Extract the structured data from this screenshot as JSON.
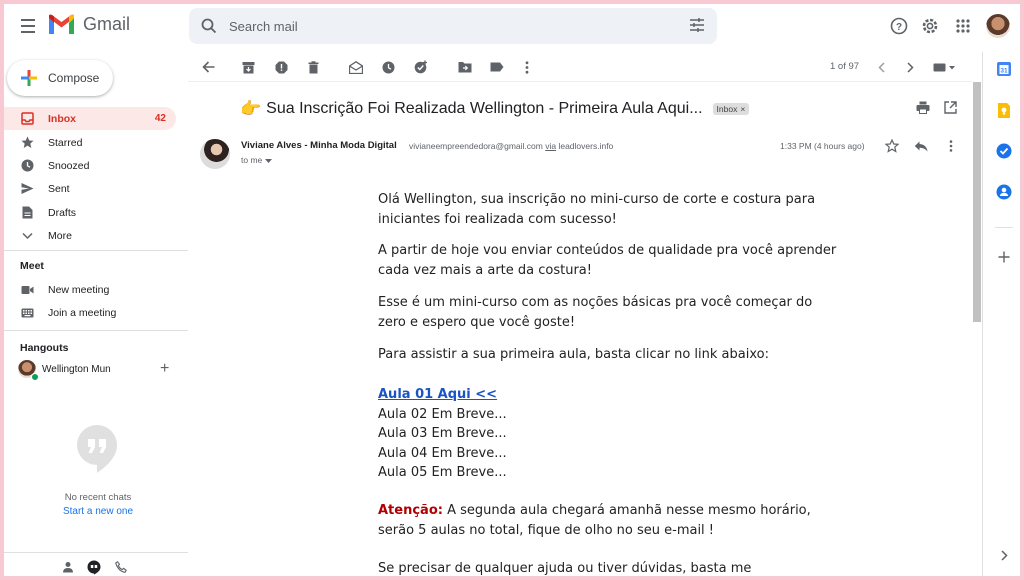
{
  "header": {
    "app_name": "Gmail",
    "search_placeholder": "Search mail"
  },
  "sidebar": {
    "compose_label": "Compose",
    "items": [
      {
        "label": "Inbox",
        "count": "42"
      },
      {
        "label": "Starred"
      },
      {
        "label": "Snoozed"
      },
      {
        "label": "Sent"
      },
      {
        "label": "Drafts"
      },
      {
        "label": "More"
      }
    ],
    "meet": {
      "title": "Meet",
      "new_meeting": "New meeting",
      "join_meeting": "Join a meeting"
    },
    "hangouts": {
      "title": "Hangouts",
      "user_name": "Wellington Mun",
      "no_recent": "No recent chats",
      "start_new": "Start a new one"
    }
  },
  "toolbar": {
    "pager": "1 of 97"
  },
  "email": {
    "subject": "Sua Inscrição Foi Realizada Wellington - Primeira Aula Aqui...",
    "label_chip": "Inbox",
    "sender_name": "Viviane Alves - Minha Moda Digital",
    "sender_email": "vivianeempreendedora@gmail.com",
    "via_text": "via",
    "via_domain": "leadlovers.info",
    "to": "to me",
    "time": "1:33 PM (4 hours ago)",
    "paragraphs": [
      "Olá Wellington, sua inscrição no mini-curso de corte e costura para iniciantes foi realizada com sucesso!",
      "A partir de hoje vou enviar conteúdos de qualidade pra você aprender cada vez mais a arte da costura!",
      "Esse é um mini-curso com as noções básicas pra você começar do zero e espero que você goste!",
      "Para assistir a sua primeira aula, basta clicar no link abaixo:"
    ],
    "aula_link": "Aula 01 Aqui <<",
    "aulas": [
      "Aula 02 Em Breve...",
      "Aula 03 Em Breve...",
      "Aula 04 Em Breve...",
      "Aula 05 Em Breve..."
    ],
    "atencao_label": "Atenção:",
    "atencao_text": "A segunda aula chegará amanhã nesse mesmo horário, serão 5 aulas no total, fique de olho no seu e-mail !",
    "last_line": "Se precisar de qualquer ajuda ou tiver dúvidas, basta me"
  },
  "colors": {
    "accent_red": "#d93025",
    "link_blue": "#1a73e8",
    "active_bg": "#fce8e6"
  }
}
